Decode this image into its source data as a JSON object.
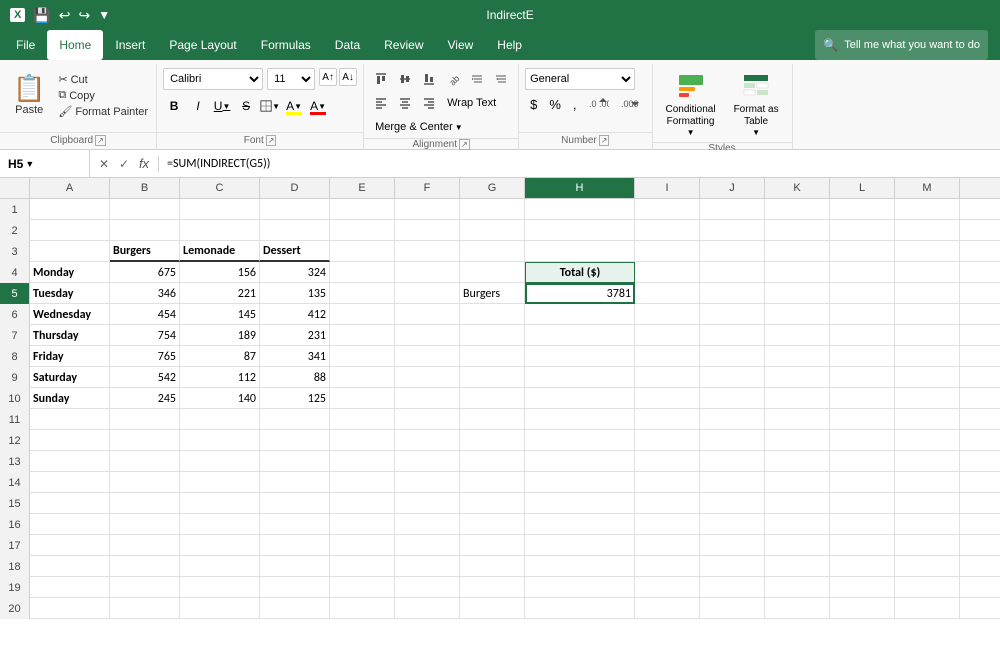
{
  "titlebar": {
    "filename": "IndirectE",
    "save_icon": "💾",
    "undo_icon": "↩",
    "redo_icon": "↪"
  },
  "menubar": {
    "items": [
      "File",
      "Home",
      "Insert",
      "Page Layout",
      "Formulas",
      "Data",
      "Review",
      "View",
      "Help"
    ],
    "active": "Home",
    "search_placeholder": "Tell me what you want to do",
    "search_icon": "🔍"
  },
  "ribbon": {
    "clipboard": {
      "paste_label": "Paste",
      "cut_label": "Cut",
      "copy_label": "Copy",
      "format_painter_label": "Format Painter",
      "group_label": "Clipboard"
    },
    "font": {
      "font_name": "Calibri",
      "font_size": "11",
      "bold": "B",
      "italic": "I",
      "underline": "U",
      "strikethrough": "S",
      "borders_label": "Borders",
      "fill_color_label": "Fill Color",
      "font_color_label": "Font Color",
      "group_label": "Font"
    },
    "alignment": {
      "wrap_text": "Wrap Text",
      "merge_center": "Merge & Center",
      "group_label": "Alignment"
    },
    "number": {
      "format": "General",
      "percent": "%",
      "comma": ",",
      "increase_decimal": ".0→.00",
      "decrease_decimal": ".00→.0",
      "currency": "$",
      "group_label": "Number"
    },
    "styles": {
      "conditional_label": "Conditional\nFormatting",
      "format_as_table_label": "Format as\nTable",
      "group_label": "Styles"
    }
  },
  "formulabar": {
    "cell_ref": "H5",
    "formula": "=SUM(INDIRECT(G5))",
    "cancel_label": "✕",
    "confirm_label": "✓",
    "function_label": "fx"
  },
  "grid": {
    "columns": [
      "A",
      "B",
      "C",
      "D",
      "E",
      "F",
      "G",
      "H",
      "I",
      "J",
      "K",
      "L",
      "M"
    ],
    "rows": [
      {
        "num": 1,
        "cells": {
          "A": "",
          "B": "",
          "C": "",
          "D": "",
          "E": "",
          "F": "",
          "G": "",
          "H": "",
          "I": "",
          "J": "",
          "K": "",
          "L": "",
          "M": ""
        }
      },
      {
        "num": 2,
        "cells": {
          "A": "",
          "B": "",
          "C": "",
          "D": "",
          "E": "",
          "F": "",
          "G": "",
          "H": "",
          "I": "",
          "J": "",
          "K": "",
          "L": "",
          "M": ""
        }
      },
      {
        "num": 3,
        "cells": {
          "A": "",
          "B": "Burgers",
          "C": "Lemonade",
          "D": "Dessert",
          "E": "",
          "F": "",
          "G": "",
          "H": "",
          "I": "",
          "J": "",
          "K": "",
          "L": "",
          "M": ""
        }
      },
      {
        "num": 4,
        "cells": {
          "A": "Monday",
          "B": "675",
          "C": "156",
          "D": "324",
          "E": "",
          "F": "",
          "G": "",
          "H": "Total ($)",
          "I": "",
          "J": "",
          "K": "",
          "L": "",
          "M": ""
        }
      },
      {
        "num": 5,
        "cells": {
          "A": "Tuesday",
          "B": "346",
          "C": "221",
          "D": "135",
          "E": "",
          "F": "",
          "G": "Burgers",
          "H": "3781",
          "I": "",
          "J": "",
          "K": "",
          "L": "",
          "M": ""
        }
      },
      {
        "num": 6,
        "cells": {
          "A": "Wednesday",
          "B": "454",
          "C": "145",
          "D": "412",
          "E": "",
          "F": "",
          "G": "",
          "H": "",
          "I": "",
          "J": "",
          "K": "",
          "L": "",
          "M": ""
        }
      },
      {
        "num": 7,
        "cells": {
          "A": "Thursday",
          "B": "754",
          "C": "189",
          "D": "231",
          "E": "",
          "F": "",
          "G": "",
          "H": "",
          "I": "",
          "J": "",
          "K": "",
          "L": "",
          "M": ""
        }
      },
      {
        "num": 8,
        "cells": {
          "A": "Friday",
          "B": "765",
          "C": "87",
          "D": "341",
          "E": "",
          "F": "",
          "G": "",
          "H": "",
          "I": "",
          "J": "",
          "K": "",
          "L": "",
          "M": ""
        }
      },
      {
        "num": 9,
        "cells": {
          "A": "Saturday",
          "B": "542",
          "C": "112",
          "D": "88",
          "E": "",
          "F": "",
          "G": "",
          "H": "",
          "I": "",
          "J": "",
          "K": "",
          "L": "",
          "M": ""
        }
      },
      {
        "num": 10,
        "cells": {
          "A": "Sunday",
          "B": "245",
          "C": "140",
          "D": "125",
          "E": "",
          "F": "",
          "G": "",
          "H": "",
          "I": "",
          "J": "",
          "K": "",
          "L": "",
          "M": ""
        }
      },
      {
        "num": 11,
        "cells": {
          "A": "",
          "B": "",
          "C": "",
          "D": "",
          "E": "",
          "F": "",
          "G": "",
          "H": "",
          "I": "",
          "J": "",
          "K": "",
          "L": "",
          "M": ""
        }
      },
      {
        "num": 12,
        "cells": {
          "A": "",
          "B": "",
          "C": "",
          "D": "",
          "E": "",
          "F": "",
          "G": "",
          "H": "",
          "I": "",
          "J": "",
          "K": "",
          "L": "",
          "M": ""
        }
      },
      {
        "num": 13,
        "cells": {
          "A": "",
          "B": "",
          "C": "",
          "D": "",
          "E": "",
          "F": "",
          "G": "",
          "H": "",
          "I": "",
          "J": "",
          "K": "",
          "L": "",
          "M": ""
        }
      },
      {
        "num": 14,
        "cells": {
          "A": "",
          "B": "",
          "C": "",
          "D": "",
          "E": "",
          "F": "",
          "G": "",
          "H": "",
          "I": "",
          "J": "",
          "K": "",
          "L": "",
          "M": ""
        }
      },
      {
        "num": 15,
        "cells": {
          "A": "",
          "B": "",
          "C": "",
          "D": "",
          "E": "",
          "F": "",
          "G": "",
          "H": "",
          "I": "",
          "J": "",
          "K": "",
          "L": "",
          "M": ""
        }
      },
      {
        "num": 16,
        "cells": {
          "A": "",
          "B": "",
          "C": "",
          "D": "",
          "E": "",
          "F": "",
          "G": "",
          "H": "",
          "I": "",
          "J": "",
          "K": "",
          "L": "",
          "M": ""
        }
      },
      {
        "num": 17,
        "cells": {
          "A": "",
          "B": "",
          "C": "",
          "D": "",
          "E": "",
          "F": "",
          "G": "",
          "H": "",
          "I": "",
          "J": "",
          "K": "",
          "L": "",
          "M": ""
        }
      },
      {
        "num": 18,
        "cells": {
          "A": "",
          "B": "",
          "C": "",
          "D": "",
          "E": "",
          "F": "",
          "G": "",
          "H": "",
          "I": "",
          "J": "",
          "K": "",
          "L": "",
          "M": ""
        }
      },
      {
        "num": 19,
        "cells": {
          "A": "",
          "B": "",
          "C": "",
          "D": "",
          "E": "",
          "F": "",
          "G": "",
          "H": "",
          "I": "",
          "J": "",
          "K": "",
          "L": "",
          "M": ""
        }
      },
      {
        "num": 20,
        "cells": {
          "A": "",
          "B": "",
          "C": "",
          "D": "",
          "E": "",
          "F": "",
          "G": "",
          "H": "",
          "I": "",
          "J": "",
          "K": "",
          "L": "",
          "M": ""
        }
      }
    ],
    "selected_cell": "H5",
    "selected_col": "H",
    "selected_row": 5
  }
}
